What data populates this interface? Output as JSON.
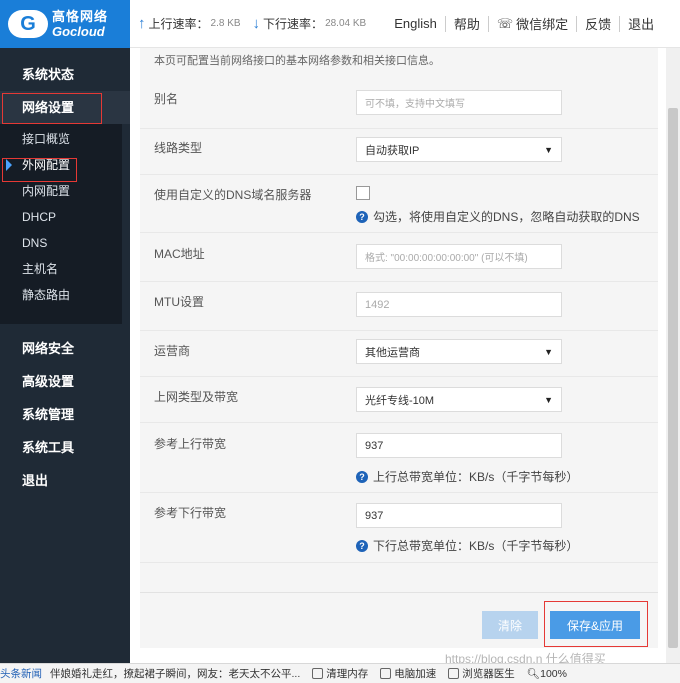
{
  "brand": {
    "name_cn": "高恪网络",
    "name_en": "Gocloud"
  },
  "topbar": {
    "upload_label": "上行速率：",
    "upload_value": "2.8 KB",
    "download_label": "下行速率：",
    "download_value": "28.04 KB",
    "links": [
      "English",
      "帮助",
      "微信绑定",
      "反馈",
      "退出"
    ]
  },
  "sidebar": {
    "items": [
      "系统状态",
      "网络设置",
      "网络安全",
      "高级设置",
      "系统管理",
      "系统工具",
      "退出"
    ],
    "sub_items": [
      "接口概览",
      "外网配置",
      "内网配置",
      "DHCP",
      "DNS",
      "主机名",
      "静态路由"
    ],
    "active_sub": "外网配置"
  },
  "content": {
    "description": "本页可配置当前网络接口的基本网络参数和相关接口信息。",
    "fields": {
      "alias": {
        "label": "别名",
        "placeholder": "可不填，支持中文填写"
      },
      "line_type": {
        "label": "线路类型",
        "value": "自动获取IP"
      },
      "custom_dns": {
        "label": "使用自定义的DNS域名服务器",
        "hint": "勾选，将使用自定义的DNS，忽略自动获取的DNS"
      },
      "mac": {
        "label": "MAC地址",
        "placeholder": "格式: \"00:00:00:00:00:00\" (可以不填)"
      },
      "mtu": {
        "label": "MTU设置",
        "placeholder": "1492"
      },
      "isp": {
        "label": "运营商",
        "value": "其他运营商"
      },
      "bandwidth_type": {
        "label": "上网类型及带宽",
        "value": "光纤专线-10M"
      },
      "upload_bw": {
        "label": "参考上行带宽",
        "value": "937",
        "hint": "上行总带宽单位：KB/s（千字节每秒）"
      },
      "download_bw": {
        "label": "参考下行带宽",
        "value": "937",
        "hint": "下行总带宽单位：KB/s（千字节每秒）"
      }
    },
    "buttons": {
      "clear": "清除",
      "save": "保存&应用"
    }
  },
  "taskbar": {
    "news_label": "头条新闻",
    "headline": "伴娘婚礼走红，撩起裙子瞬间，网友：老天太不公平...",
    "items": [
      "清理内存",
      "电脑加速",
      "浏览器医生"
    ],
    "zoom": "100%"
  },
  "watermark": "https://blog.csdn.n 什么值得买"
}
